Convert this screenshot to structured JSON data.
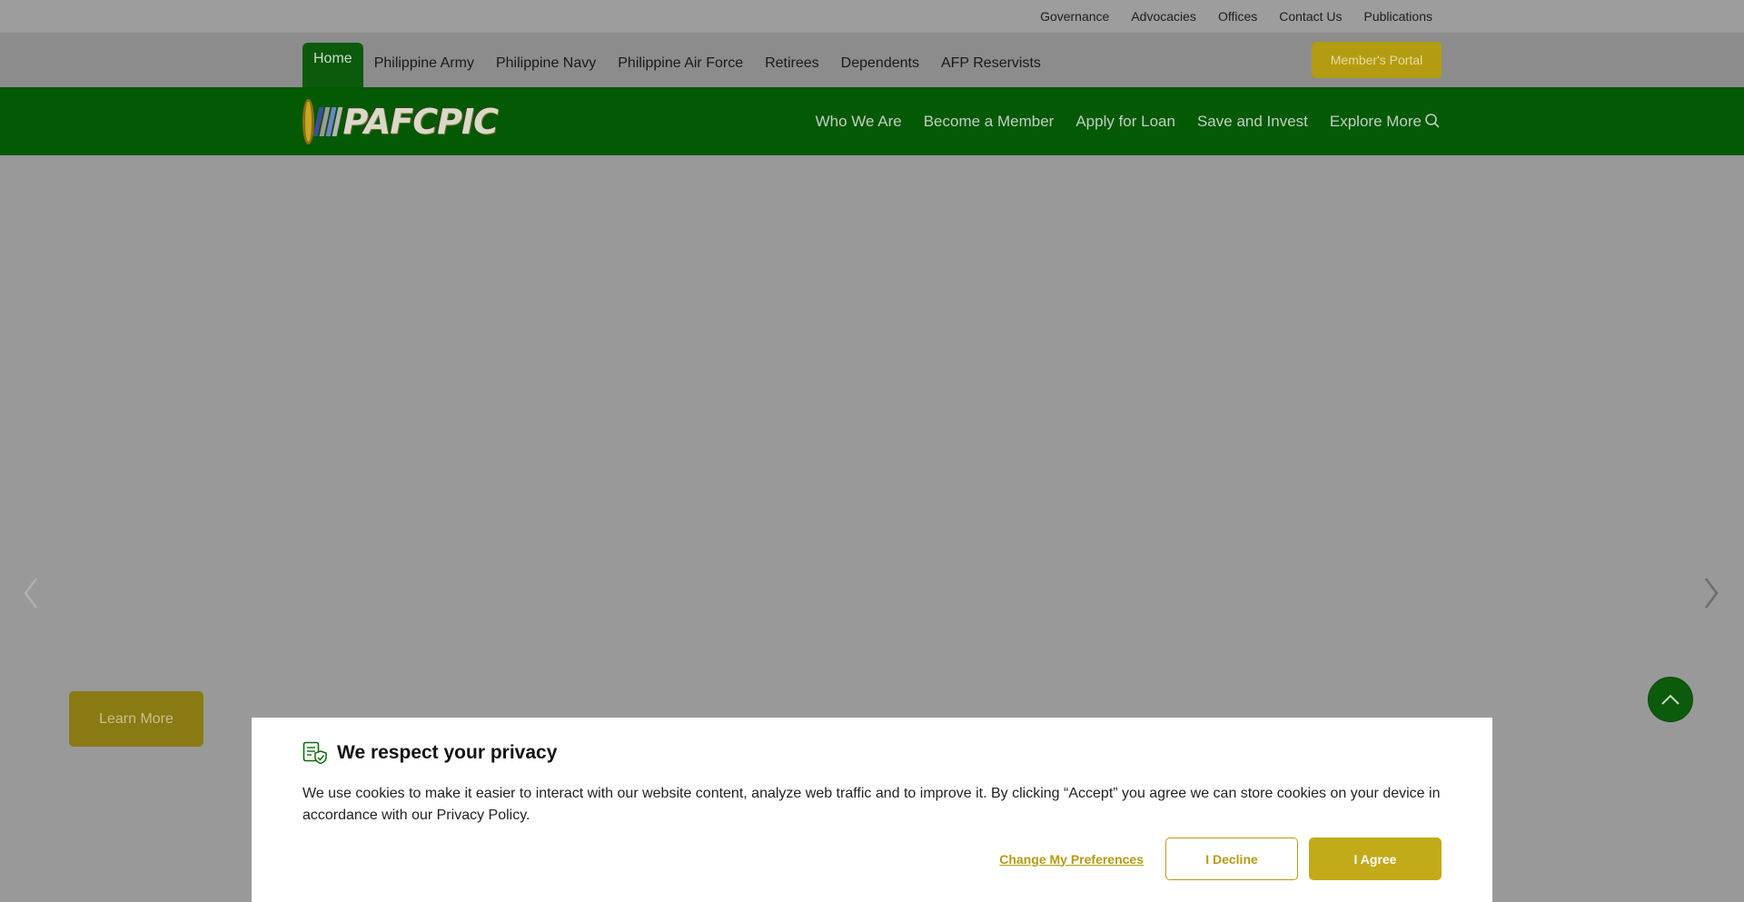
{
  "topbar": {
    "links": [
      "Governance",
      "Advocacies",
      "Offices",
      "Contact Us",
      "Publications"
    ]
  },
  "branchbar": {
    "tabs": [
      "Home",
      "Philippine Army",
      "Philippine Navy",
      "Philippine Air Force",
      "Retirees",
      "Dependents",
      "AFP Reservists"
    ],
    "active_tab": "Home",
    "portal_label": "Member's Portal"
  },
  "mainnav": {
    "logo_text": "PAFCPIC",
    "links": [
      "Who We Are",
      "Become a Member",
      "Apply for Loan",
      "Save and Invest",
      "Explore More"
    ],
    "search_icon": "search-icon"
  },
  "hero": {
    "cta_label": "Learn More",
    "prev_icon": "chevron-left-icon",
    "next_icon": "chevron-right-icon",
    "scroll_top_icon": "chevron-up-icon"
  },
  "cookie": {
    "title": "We respect your privacy",
    "text": "We use cookies to make it easier to interact with our website content, analyze web traffic and to improve it. By clicking “Accept” you agree we can store cookies on your device in accordance with our Privacy Policy.",
    "preferences_label": "Change My Preferences",
    "decline_label": "I Decline",
    "agree_label": "I Agree",
    "icon": "document-shield-icon"
  },
  "colors": {
    "green": "#045904",
    "gold": "#c3aa18",
    "overlay_gray": "#999999"
  }
}
